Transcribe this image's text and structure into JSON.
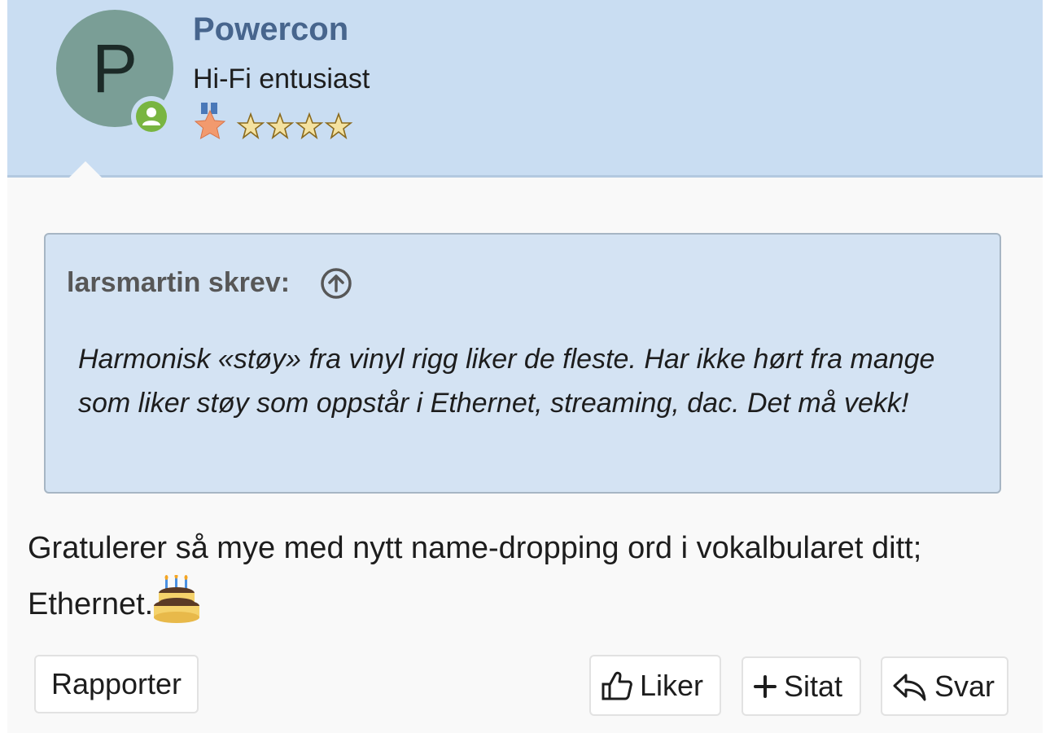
{
  "author": {
    "avatar_letter": "P",
    "username": "Powercon",
    "title": "Hi-Fi entusiast",
    "online_status_icon": "user-online-icon",
    "rank_icons": [
      "medal-icon",
      "star-icon",
      "star-icon",
      "star-icon",
      "star-icon"
    ],
    "colors": {
      "header_bg": "#c9ddf2",
      "username": "#47658d",
      "avatar_bg": "#7a9e96",
      "online": "#79b541"
    }
  },
  "quote": {
    "author_label": "larsmartin skrev:",
    "jump_icon": "arrow-up-circle-icon",
    "text": "Harmonisk «støy» fra vinyl rigg liker de fleste. Har ikke hørt fra mange som liker støy som oppstår i Ethernet, streaming, dac. Det må vekk!"
  },
  "message": {
    "text": "Gratulerer så mye med nytt name-dropping ord i vokalbularet ditt; Ethernet.",
    "emoji_icon": "birthday-cake-icon"
  },
  "actions": {
    "report_label": "Rapporter",
    "like_label": "Liker",
    "quote_label": "Sitat",
    "reply_label": "Svar"
  }
}
